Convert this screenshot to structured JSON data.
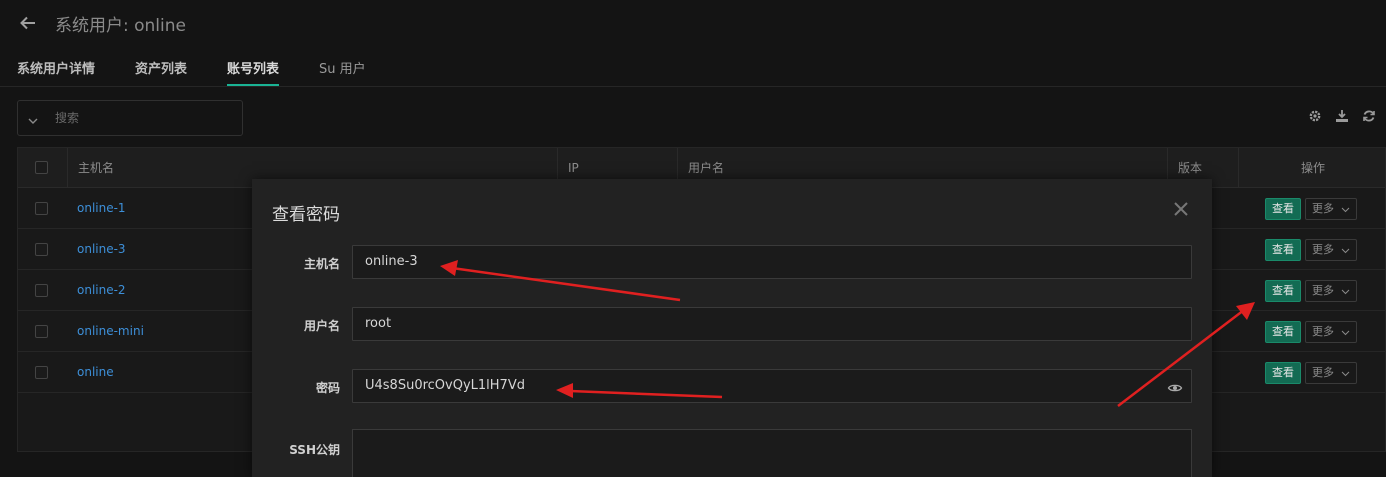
{
  "header": {
    "title": "系统用户: online"
  },
  "tabs": [
    {
      "label": "系统用户详情"
    },
    {
      "label": "资产列表"
    },
    {
      "label": "账号列表"
    },
    {
      "label": "Su 用户"
    }
  ],
  "search": {
    "placeholder": "搜索"
  },
  "toolbar": {
    "icons": [
      "gear-icon",
      "download-icon",
      "refresh-icon"
    ]
  },
  "table": {
    "columns": [
      "主机名",
      "IP",
      "用户名",
      "版本",
      "操作"
    ],
    "rows": [
      {
        "hostname": "online-1"
      },
      {
        "hostname": "online-3"
      },
      {
        "hostname": "online-2"
      },
      {
        "hostname": "online-mini"
      },
      {
        "hostname": "online"
      }
    ],
    "view_label": "查看",
    "more_label": "更多"
  },
  "modal": {
    "title": "查看密码",
    "fields": {
      "hostname_label": "主机名",
      "hostname_value": "online-3",
      "username_label": "用户名",
      "username_value": "root",
      "password_label": "密码",
      "password_value": "U4s8Su0rcOvQyL1lH7Vd",
      "sshkey_label": "SSH公钥"
    }
  },
  "colors": {
    "accent": "#1ab394",
    "link": "#3d8fd8",
    "view_button": "#136b53",
    "annotation_arrow": "#e02020"
  }
}
